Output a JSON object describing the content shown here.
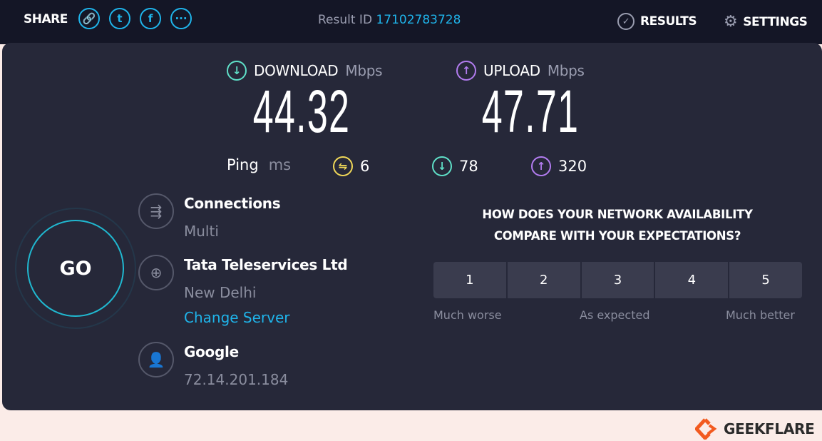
{
  "header": {
    "share_label": "SHARE",
    "share_icons": [
      "link-icon",
      "twitter-icon",
      "facebook-icon",
      "more-icon"
    ],
    "result_id_label": "Result ID",
    "result_id": "17102783728",
    "results_label": "RESULTS",
    "settings_label": "SETTINGS"
  },
  "download": {
    "label": "DOWNLOAD",
    "unit": "Mbps",
    "value": "44.32",
    "color": "#5fe0c8"
  },
  "upload": {
    "label": "UPLOAD",
    "unit": "Mbps",
    "value": "47.71",
    "color": "#b27cf0"
  },
  "ping": {
    "label": "Ping",
    "unit": "ms",
    "idle": "6",
    "download": "78",
    "upload": "320",
    "idle_color": "#f0d858"
  },
  "go_label": "GO",
  "connections": {
    "title": "Connections",
    "value": "Multi"
  },
  "isp": {
    "title": "Tata Teleservices Ltd",
    "location": "New Delhi",
    "change_server": "Change Server"
  },
  "host": {
    "title": "Google",
    "ip": "72.14.201.184"
  },
  "survey": {
    "line1": "HOW DOES YOUR NETWORK AVAILABILITY",
    "line2": "COMPARE WITH YOUR EXPECTATIONS?",
    "options": [
      "1",
      "2",
      "3",
      "4",
      "5"
    ],
    "low": "Much worse",
    "mid": "As expected",
    "high": "Much better"
  },
  "watermark": "GEEKFLARE",
  "accent": "#1fb4ea"
}
